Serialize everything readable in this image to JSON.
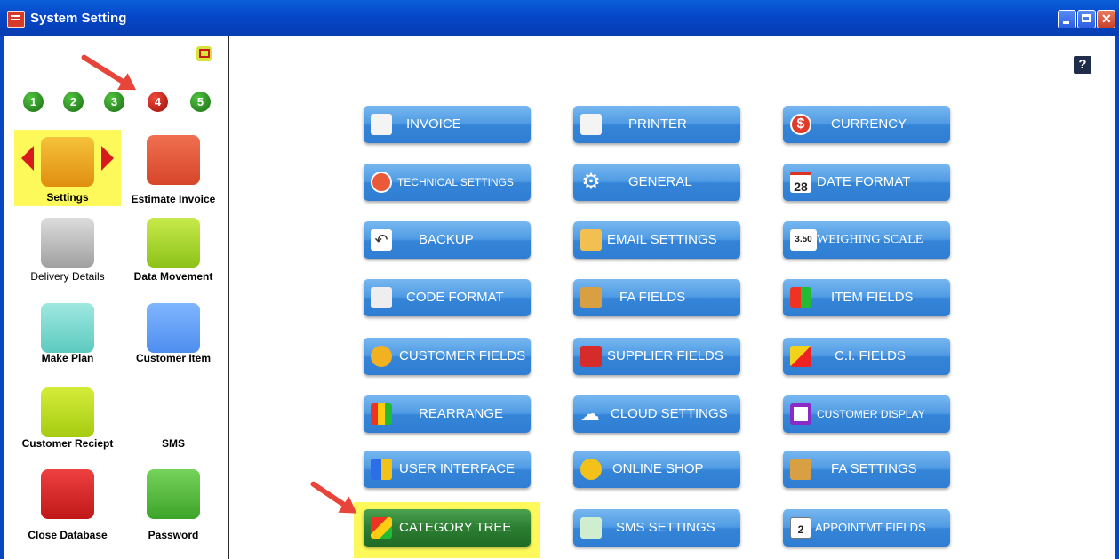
{
  "window": {
    "title": "System Setting"
  },
  "sidebar": {
    "steps": [
      "1",
      "2",
      "3",
      "4",
      "5"
    ],
    "active_step": "4",
    "items": [
      {
        "label": "Settings"
      },
      {
        "label": "Estimate Invoice"
      },
      {
        "label": "Delivery Details"
      },
      {
        "label": "Data Movement"
      },
      {
        "label": "Make Plan"
      },
      {
        "label": "Customer Item"
      },
      {
        "label": "Customer Reciept"
      },
      {
        "label": "SMS"
      },
      {
        "label": "Close Database"
      },
      {
        "label": "Password"
      }
    ]
  },
  "main": {
    "help": "?",
    "tiles": [
      {
        "label": "INVOICE",
        "icon": "invoice-icon"
      },
      {
        "label": "PRINTER",
        "icon": "printer-icon"
      },
      {
        "label": "CURRENCY",
        "icon": "currency-icon"
      },
      {
        "label": "TECHNICAL SETTINGS",
        "icon": "tools-icon"
      },
      {
        "label": "GENERAL",
        "icon": "gear-icon"
      },
      {
        "label": "DATE FORMAT",
        "icon": "calendar-icon",
        "icon_text": "28"
      },
      {
        "label": "BACKUP",
        "icon": "undo-icon"
      },
      {
        "label": "EMAIL SETTINGS",
        "icon": "envelope-icon"
      },
      {
        "label": "WEIGHING SCALE",
        "icon": "scale-icon",
        "icon_text": "3.50"
      },
      {
        "label": "CODE FORMAT",
        "icon": "code-format-icon"
      },
      {
        "label": "FA FIELDS",
        "icon": "coins-icon"
      },
      {
        "label": "ITEM FIELDS",
        "icon": "item-fields-icon"
      },
      {
        "label": "CUSTOMER FIELDS",
        "icon": "customers-icon"
      },
      {
        "label": "SUPPLIER FIELDS",
        "icon": "truck-icon"
      },
      {
        "label": "C.I. FIELDS",
        "icon": "shapes-icon"
      },
      {
        "label": "REARRANGE",
        "icon": "rearrange-icon"
      },
      {
        "label": "CLOUD SETTINGS",
        "icon": "cloud-icon"
      },
      {
        "label": "CUSTOMER DISPLAY",
        "icon": "display-icon"
      },
      {
        "label": "USER INTERFACE",
        "icon": "ui-grid-icon"
      },
      {
        "label": "ONLINE SHOP",
        "icon": "globe-icon"
      },
      {
        "label": "FA SETTINGS",
        "icon": "coins-settings-icon"
      },
      {
        "label": "CATEGORY TREE",
        "icon": "category-tree-icon"
      },
      {
        "label": "SMS SETTINGS",
        "icon": "sms-icon"
      },
      {
        "label": "APPOINTMT FIELDS",
        "icon": "appointment-icon",
        "icon_text": "2"
      }
    ]
  }
}
